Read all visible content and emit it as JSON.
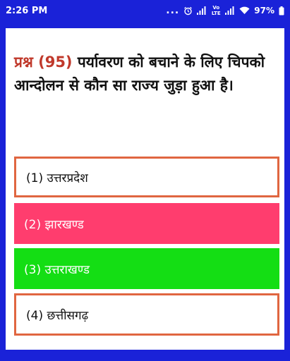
{
  "status_bar": {
    "time": "2:26 PM",
    "dots": "...",
    "volte_label": "Vo LTE",
    "battery_percent": "97%",
    "colors": {
      "background": "#1a22d8",
      "text": "#ffffff"
    }
  },
  "question": {
    "number_label": "प्रश्न (95)",
    "text": "पर्यावरण को बचाने के लिए चिपको आन्दोलन से कौन सा राज्य जुड़ा हुआ है।"
  },
  "options": [
    {
      "label": "(1) उत्तरप्रदेश",
      "state": "default"
    },
    {
      "label": "(2) झारखण्ड",
      "state": "wrong"
    },
    {
      "label": "(3) उत्तराखण्ड",
      "state": "correct"
    },
    {
      "label": "(4) छत्तीसगढ़",
      "state": "default"
    }
  ],
  "colors": {
    "page_background": "#1a22d8",
    "card_background": "#ffffff",
    "question_number": "#c0392b",
    "option_border": "#e06640",
    "wrong_fill": "#ff3d6e",
    "correct_fill": "#14de14"
  }
}
